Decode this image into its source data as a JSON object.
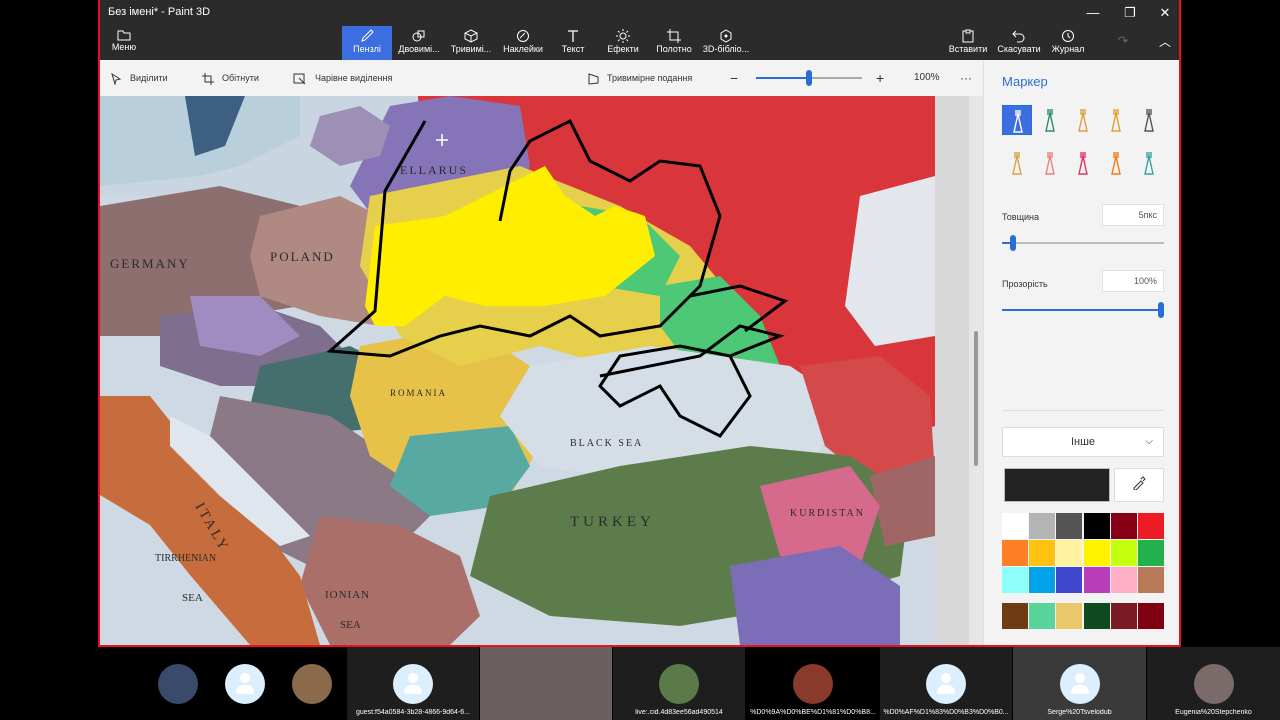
{
  "window": {
    "title": "Без імені* - Paint 3D",
    "minimize": "—",
    "maximize": "❐",
    "close": "✕"
  },
  "ribbon": {
    "menu": "Меню",
    "tabs": [
      "Пензлі",
      "Двовимі...",
      "Тривимі...",
      "Наклейки",
      "Текст",
      "Ефекти",
      "Полотно",
      "3D-бібліо..."
    ],
    "paste": "Вставити",
    "undo": "Скасувати",
    "history": "Журнал"
  },
  "toolbar": {
    "select": "Виділити",
    "crop": "Обітнути",
    "magic_select": "Чарівне виділення",
    "view3d": "Тривимірне подання",
    "zoom": "100%",
    "zoom_level": 0.5
  },
  "map": {
    "labels": [
      "GERMANY",
      "POLAND",
      "ELLARUS",
      "TURKEY",
      "BLACK SEA",
      "IONIAN",
      "SEA",
      "SEA",
      "TIRRHENIAN",
      "KURDISTAN",
      "ITALY",
      "ROMANIA"
    ]
  },
  "panel": {
    "title": "Маркер",
    "thickness_label": "Товщина",
    "thickness_value": "5пкс",
    "thickness_level": 0.05,
    "opacity_label": "Прозорість",
    "opacity_value": "100%",
    "opacity_level": 1.0,
    "dropdown": "Інше",
    "current_color": "#232323",
    "brushes": [
      "marker-icon",
      "calligraphy-pen-icon",
      "oil-brush-icon",
      "watercolor-icon",
      "pixel-pen-icon",
      "pencil-icon",
      "eraser-icon",
      "crayon-icon",
      "spray-can-icon",
      "fill-icon"
    ],
    "palette": [
      "#ffffff",
      "#b4b4b4",
      "#555555",
      "#000000",
      "#880015",
      "#ed1c24",
      "#ff7f27",
      "#ffc20e",
      "#fff2a1",
      "#fff200",
      "#c4ff0e",
      "#22b14c",
      "#8cfffb",
      "#00a2e8",
      "#3f48cc",
      "#b83dba",
      "#ffaec8",
      "#b97a57"
    ],
    "custom": [
      "#6e3b14",
      "#59d49a",
      "#e8c86b",
      "#0e4a1e",
      "#7a1a24",
      "#7f0010"
    ]
  },
  "participants": [
    {
      "name": "",
      "type": "photo",
      "color": "#3a4a6a"
    },
    {
      "name": "",
      "type": "default"
    },
    {
      "name": "",
      "type": "photo",
      "color": "#8a6a4a"
    },
    {
      "name": "guest:f54a0584-3b28-4866-9d64-6...",
      "type": "default"
    },
    {
      "name": "",
      "type": "video"
    },
    {
      "name": "live:.cid.4d83ee56ad490514",
      "type": "photo",
      "color": "#5a7a4a"
    },
    {
      "name": "%D0%9A%D0%BE%D1%81%D0%B8...",
      "type": "photo",
      "color": "#8a3a2a"
    },
    {
      "name": "%D0%AF%D1%83%D0%B3%D0%B0...",
      "type": "default"
    },
    {
      "name": "Serge%20Tsvelodub",
      "type": "default"
    },
    {
      "name": "Eugenia%20Stepchenko",
      "type": "photo",
      "color": "#7a6a6a"
    }
  ]
}
